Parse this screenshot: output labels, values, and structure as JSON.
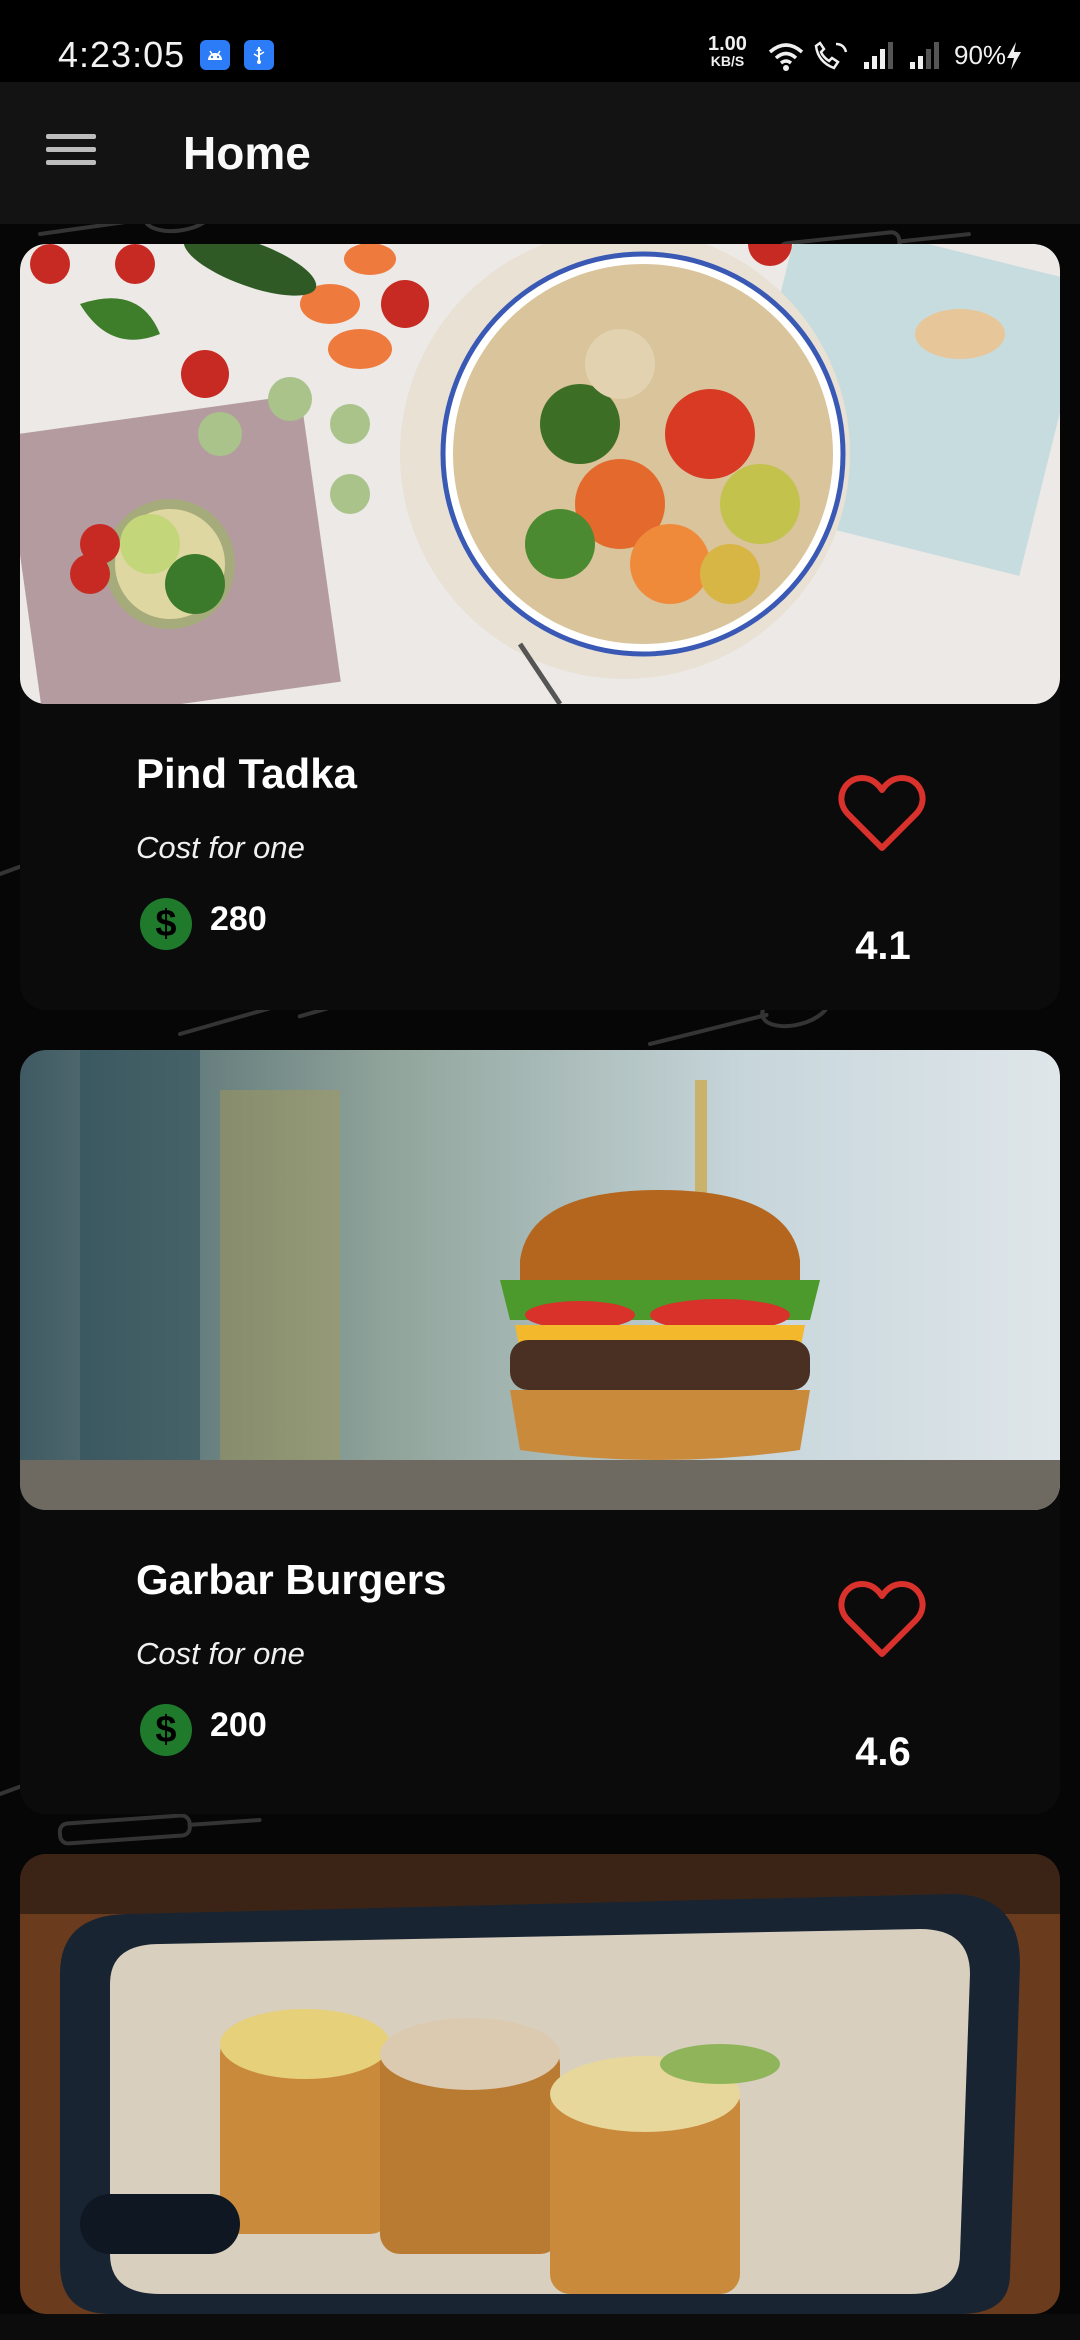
{
  "status_bar": {
    "time": "4:23:05",
    "speed_value": "1.00",
    "speed_unit": "KB/S",
    "battery": "90%"
  },
  "app_bar": {
    "title": "Home"
  },
  "restaurants": [
    {
      "name": "Pind Tadka",
      "cost_label": "Cost for one",
      "cost": "280",
      "rating": "4.1",
      "currency_icon": "dollar-icon"
    },
    {
      "name": "Garbar Burgers",
      "cost_label": "Cost for one",
      "cost": "200",
      "rating": "4.6",
      "currency_icon": "dollar-icon"
    }
  ],
  "colors": {
    "background": "#060606",
    "card": "#0b0b0b",
    "heart": "#d9312b",
    "dollar": "#1f7a2c"
  }
}
